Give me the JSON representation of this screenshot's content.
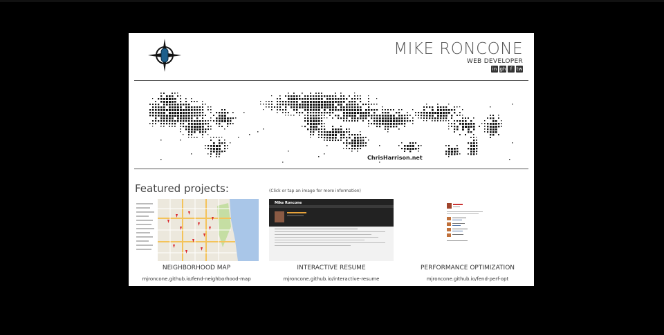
{
  "header": {
    "name": "MIKE RONCONE",
    "role": "WEB DEVELOPER",
    "social": [
      "in",
      "gh",
      "f",
      "tw"
    ]
  },
  "map_credit": "ChrisHarrison.net",
  "featured": {
    "heading": "Featured projects:",
    "hint": "(Click or tap an image for more information)",
    "projects": [
      {
        "title": "NEIGHBORHOOD MAP",
        "link": "mjroncone.github.io/fend-neighborhood-map"
      },
      {
        "title": "INTERACTIVE RESUME",
        "link": "mjroncone.github.io/interactive-resume"
      },
      {
        "title": "PERFORMANCE OPTIMIZATION",
        "link": "mjroncone.github.io/fend-perf-opt"
      }
    ]
  },
  "resume_thumb": {
    "name": "Mike Roncone"
  },
  "colors": {
    "accent": "#1c5f8c",
    "background": "#000000"
  }
}
